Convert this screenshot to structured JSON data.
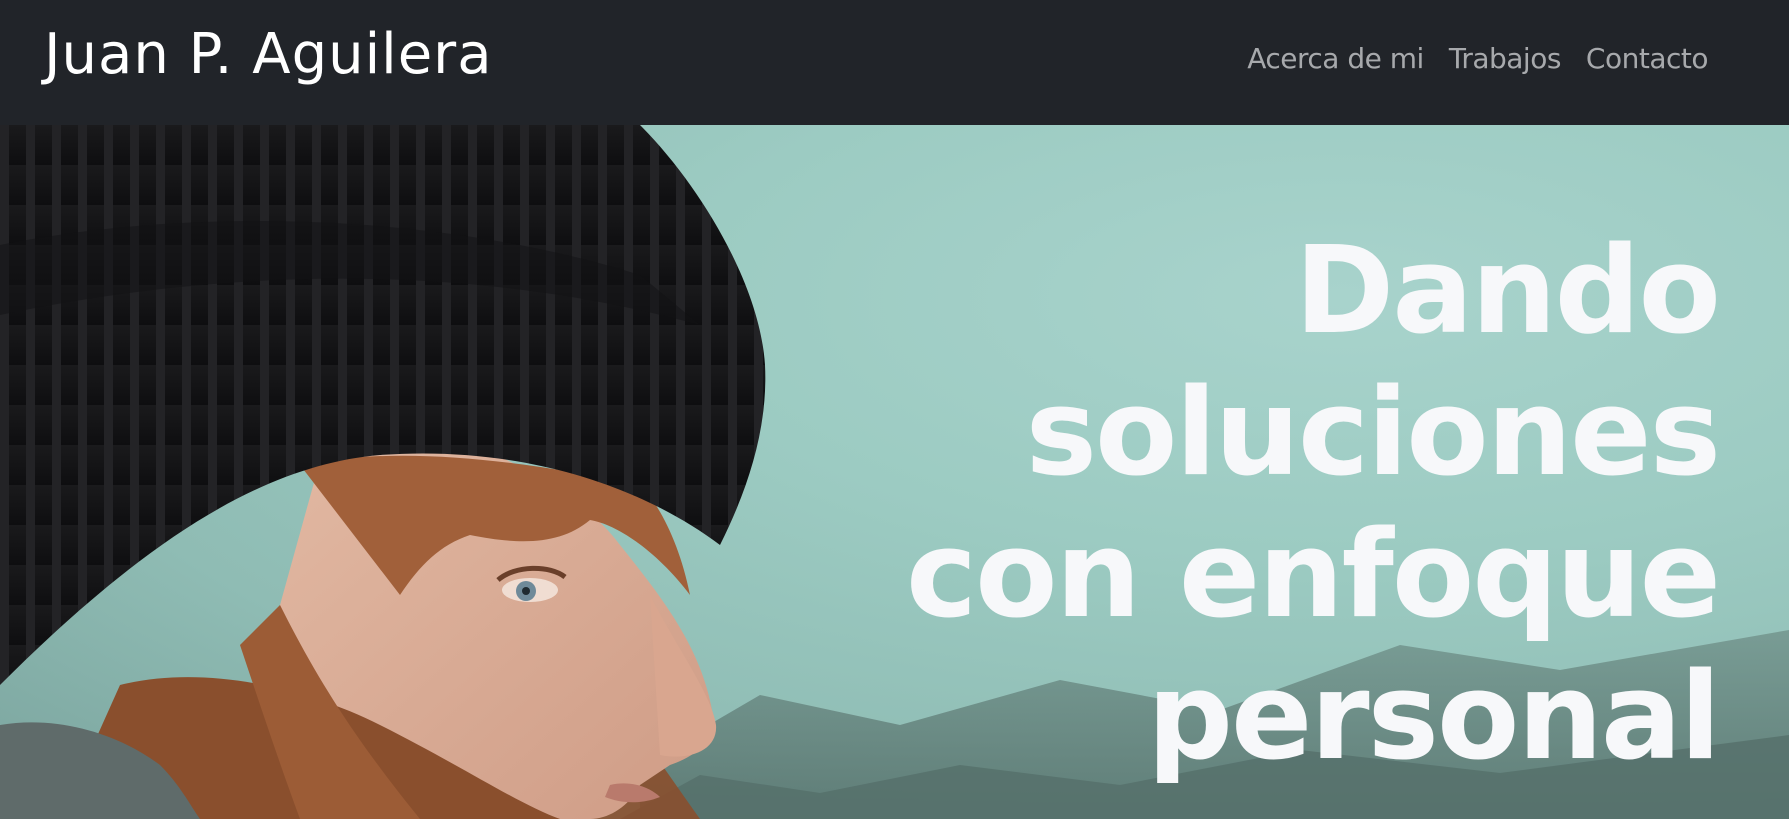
{
  "navbar": {
    "brand": "Juan P. Aguilera",
    "links": [
      "Acerca de mi",
      "Trabajos",
      "Contacto"
    ]
  },
  "hero": {
    "headline": "Dando soluciones con enfoque personal",
    "image": "woman-in-black-beanie-portrait"
  },
  "colors": {
    "navbar_bg": "#212429",
    "nav_link": "#a7a9ac",
    "hero_text": "#f7f8fa",
    "hero_bg": "#9ccbc2"
  }
}
